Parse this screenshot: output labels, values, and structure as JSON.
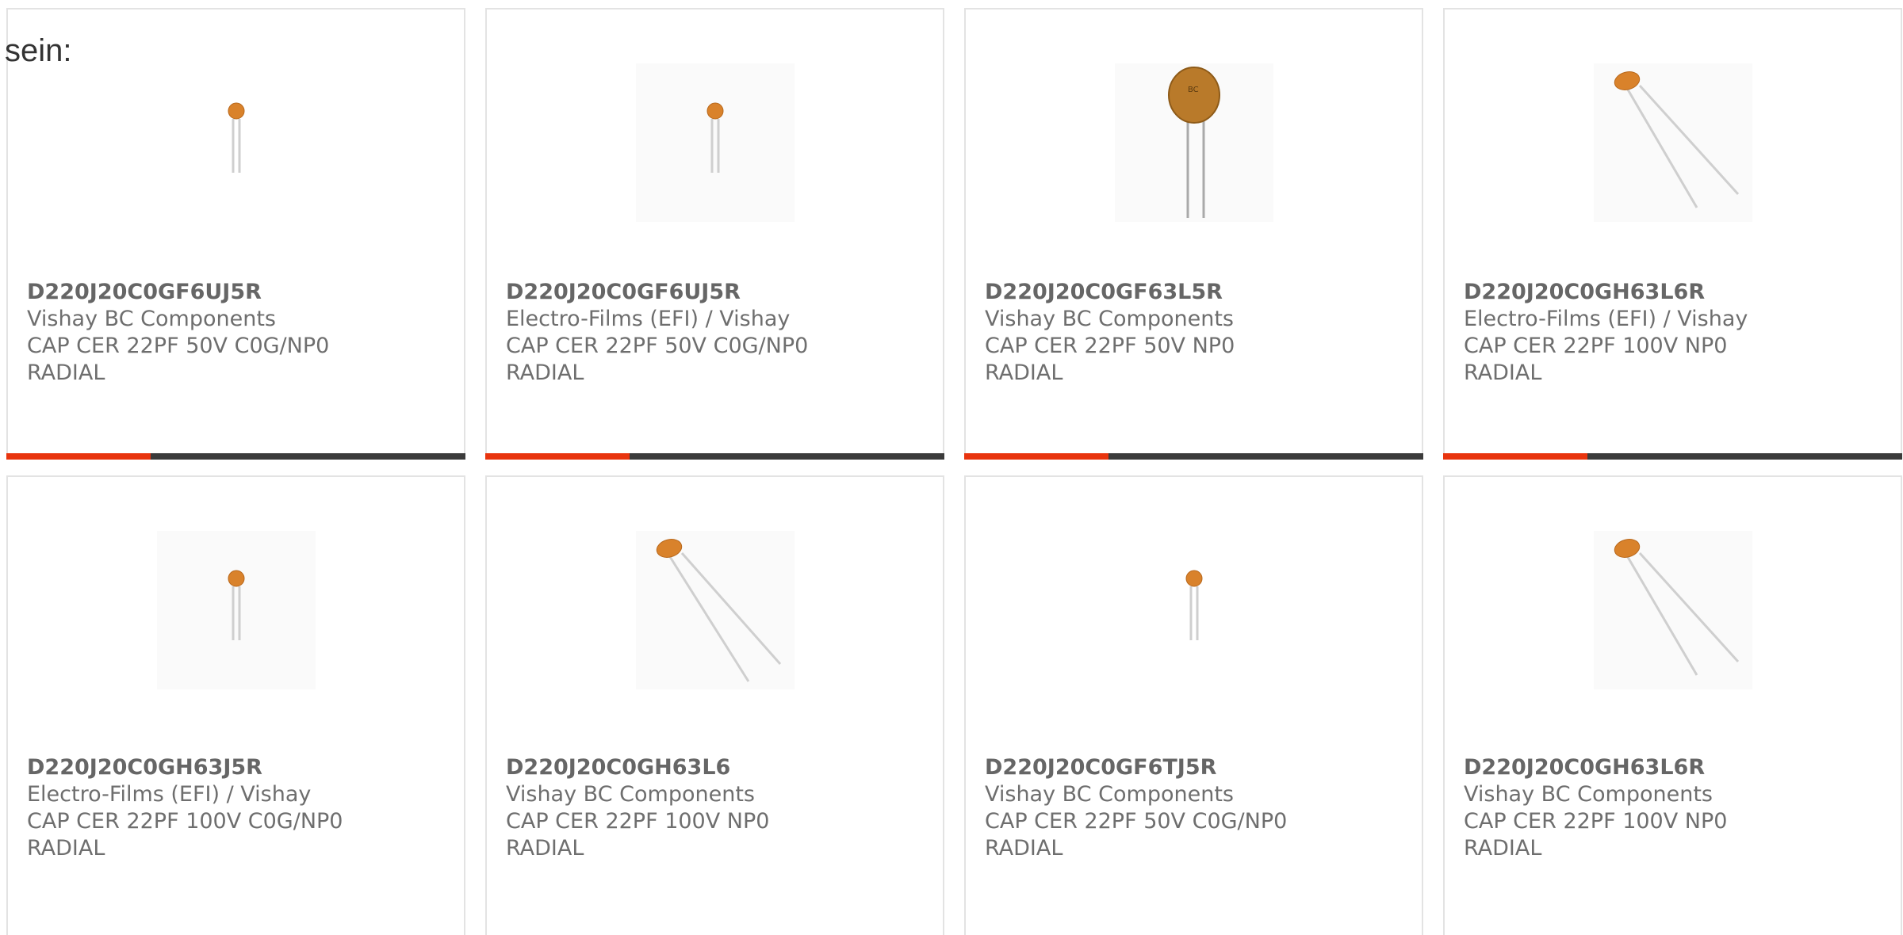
{
  "intro_text": "sein:",
  "accent_color": "#e8340e",
  "bar_color": "#3b3b3b",
  "products": [
    {
      "part_number": "D220J20C0GF6UJ5R",
      "manufacturer": "Vishay BC Components",
      "description": "CAP CER 22PF 50V C0G/NP0 RADIAL",
      "image": "capacitor-small-upright"
    },
    {
      "part_number": "D220J20C0GF6UJ5R",
      "manufacturer": "Electro-Films (EFI) / Vishay",
      "description": "CAP CER 22PF 50V C0G/NP0 RADIAL",
      "image": "capacitor-small-upright"
    },
    {
      "part_number": "D220J20C0GF63L5R",
      "manufacturer": "Vishay BC Components",
      "description": "CAP CER 22PF 50V NP0 RADIAL",
      "image": "capacitor-disc-large"
    },
    {
      "part_number": "D220J20C0GH63L6R",
      "manufacturer": "Electro-Films (EFI) / Vishay",
      "description": "CAP CER 22PF 100V NP0 RADIAL",
      "image": "capacitor-angled"
    },
    {
      "part_number": "D220J20C0GH63J5R",
      "manufacturer": "Electro-Films (EFI) / Vishay",
      "description": "CAP CER 22PF 100V C0G/NP0 RADIAL",
      "image": "capacitor-small-upright"
    },
    {
      "part_number": "D220J20C0GH63L6",
      "manufacturer": "Vishay BC Components",
      "description": "CAP CER 22PF 100V NP0 RADIAL",
      "image": "capacitor-angled"
    },
    {
      "part_number": "D220J20C0GF6TJ5R",
      "manufacturer": "Vishay BC Components",
      "description": "CAP CER 22PF 50V C0G/NP0 RADIAL",
      "image": "capacitor-small-upright"
    },
    {
      "part_number": "D220J20C0GH63L6R",
      "manufacturer": "Vishay BC Components",
      "description": "CAP CER 22PF 100V NP0 RADIAL",
      "image": "capacitor-angled"
    }
  ]
}
